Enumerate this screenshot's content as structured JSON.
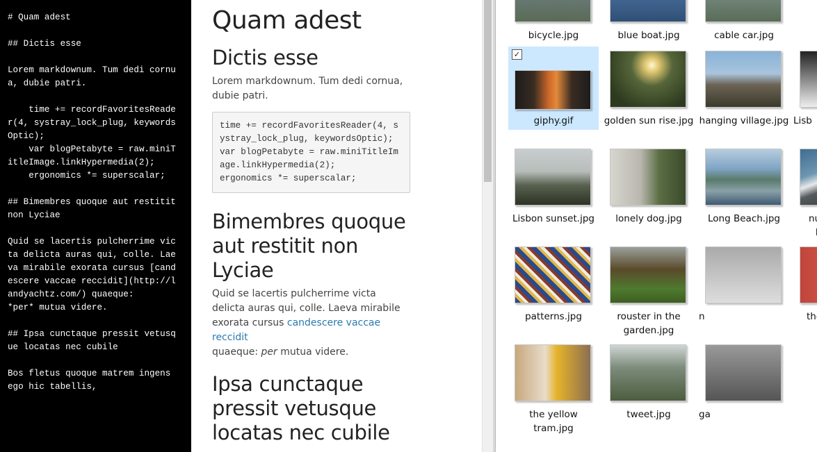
{
  "editor": {
    "lines": [
      "# Quam adest",
      "",
      "## Dictis esse",
      "",
      "Lorem markdownum. Tum dedi cornua, dubie patri.",
      "",
      "    time += recordFavoritesReader(4, systray_lock_plug, keywordsOptic);",
      "    var blogPetabyte = raw.miniTitleImage.linkHypermedia(2);",
      "    ergonomics *= superscalar;",
      "",
      "## Bimembres quoque aut restitit non Lyciae",
      "",
      "Quid se lacertis pulcherrime victa delicta auras qui, colle. Laeva mirabile exorata cursus [candescere vaccae reccidit](http://landyachtz.com/) quaeque:",
      "*per* mutua videre.",
      "",
      "## Ipsa cunctaque pressit vetusque locatas nec cubile",
      "",
      "Bos fletus quoque matrem ingens ego hic tabellis,"
    ]
  },
  "preview": {
    "h1": "Quam adest",
    "h2_1": "Dictis esse",
    "p1": "Lorem markdownum. Tum dedi cornua, dubie patri.",
    "code": "time += recordFavoritesReader(4, systray_lock_plug, keywordsOptic);\nvar blogPetabyte = raw.miniTitleImage.linkHypermedia(2);\nergonomics *= superscalar;",
    "h2_2": "Bimembres quoque aut restitit non Lyciae",
    "p2_before": "Quid se lacertis pulcherrime victa delicta auras qui, colle. Laeva mirabile exorata cursus ",
    "p2_link": "candescere vaccae reccidit",
    "p2_after": " quaeque: ",
    "p2_em": "per",
    "p2_end": " mutua videre.",
    "h2_3": "Ipsa cunctaque pressit vetusque locatas nec cubile"
  },
  "explorer": {
    "files": [
      {
        "name": "bicycle.jpg"
      },
      {
        "name": "blue boat.jpg"
      },
      {
        "name": "cable car.jpg"
      },
      {
        "name": "giphy.gif",
        "selected": true,
        "checked": "✓"
      },
      {
        "name": "golden sun rise.jpg"
      },
      {
        "name": "hanging village.jpg"
      },
      {
        "name": "Lisb"
      },
      {
        "name": "Lisbon sunset.jpg"
      },
      {
        "name": "lonely dog.jpg"
      },
      {
        "name": "Long Beach.jpg"
      },
      {
        "name": "nudist at the beach.jpg"
      },
      {
        "name": "patterns.jpg"
      },
      {
        "name": "rouster in the garden.jpg"
      },
      {
        "name": "n"
      },
      {
        "name": "the no graffiti wall.jpg"
      },
      {
        "name": "the yellow tram.jpg"
      },
      {
        "name": "tweet.jpg"
      },
      {
        "name": "ga"
      }
    ]
  }
}
